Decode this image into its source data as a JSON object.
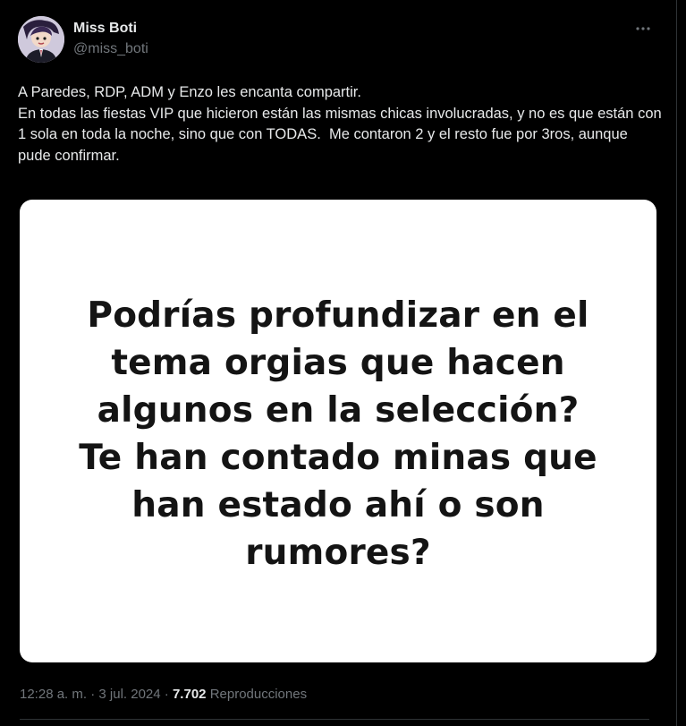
{
  "tweet": {
    "author": {
      "display_name": "Miss Boti",
      "handle": "@miss_boti"
    },
    "more_icon": "more-horizontal-icon",
    "text_lines": [
      "A Paredes, RDP, ADM y Enzo les encanta compartir.",
      "En todas las fiestas VIP que hicieron están las mismas chicas involucradas, y no es que están con 1 sola en toda la noche, sino que con TODAS.  Me contaron 2 y el resto fue por 3ros, aunque pude confirmar."
    ],
    "media": {
      "text": "Podrías profundizar en el tema orgias que hacen algunos en la selección? Te han contado minas que han estado ahí o son rumores?"
    },
    "meta": {
      "time": "12:28 a. m.",
      "separator": "·",
      "date": "3 jul. 2024",
      "views_count": "7.702",
      "views_label": "Reproducciones"
    }
  },
  "colors": {
    "background": "#000000",
    "text_primary": "#e7e9ea",
    "text_secondary": "#71767b",
    "border": "#2f3336",
    "media_background": "#ffffff"
  }
}
